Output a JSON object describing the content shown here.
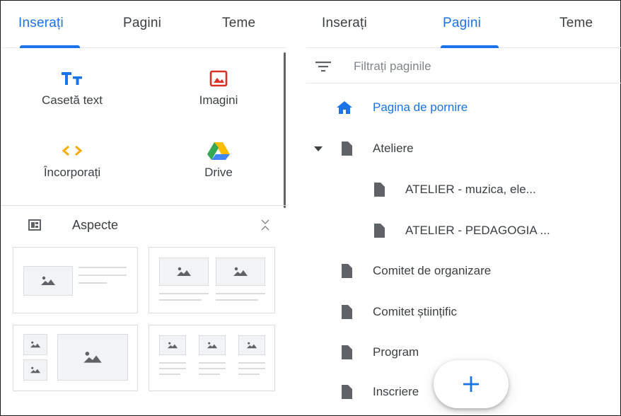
{
  "left_panel": {
    "tabs": [
      {
        "label": "Inserați",
        "active": true
      },
      {
        "label": "Pagini",
        "active": false
      },
      {
        "label": "Teme",
        "active": false
      }
    ],
    "insert_items": [
      {
        "label": "Casetă text",
        "icon": "text-box-icon"
      },
      {
        "label": "Imagini",
        "icon": "image-icon"
      },
      {
        "label": "Încorporați",
        "icon": "embed-code-icon"
      },
      {
        "label": "Drive",
        "icon": "google-drive-icon"
      }
    ],
    "layouts_section": {
      "label": "Aspecte",
      "icon": "layouts-icon",
      "toggle_icon": "collapse-icon"
    }
  },
  "right_panel": {
    "tabs": [
      {
        "label": "Inserați",
        "active": false
      },
      {
        "label": "Pagini",
        "active": true
      },
      {
        "label": "Teme",
        "active": false
      }
    ],
    "filter": {
      "placeholder": "Filtrați paginile",
      "icon": "filter-icon"
    },
    "pages": [
      {
        "label": "Pagina de pornire",
        "icon": "home-icon",
        "home": true
      },
      {
        "label": "Ateliere",
        "icon": "page-icon",
        "expanded": true
      },
      {
        "label": "ATELIER - muzica, ele...",
        "icon": "page-icon",
        "level": 1
      },
      {
        "label": "ATELIER - PEDAGOGIA ...",
        "icon": "page-icon",
        "level": 1
      },
      {
        "label": "Comitet de organizare",
        "icon": "page-icon"
      },
      {
        "label": "Comitet științific",
        "icon": "page-icon"
      },
      {
        "label": "Program",
        "icon": "page-icon"
      },
      {
        "label": "Inscriere",
        "icon": "page-icon"
      }
    ],
    "fab": {
      "icon": "add-icon"
    }
  },
  "colors": {
    "accent": "#1a73e8",
    "text": "#3c4043",
    "muted": "#80868b",
    "divider": "#dadce0",
    "placeholder_fill": "#f1f3f4"
  }
}
